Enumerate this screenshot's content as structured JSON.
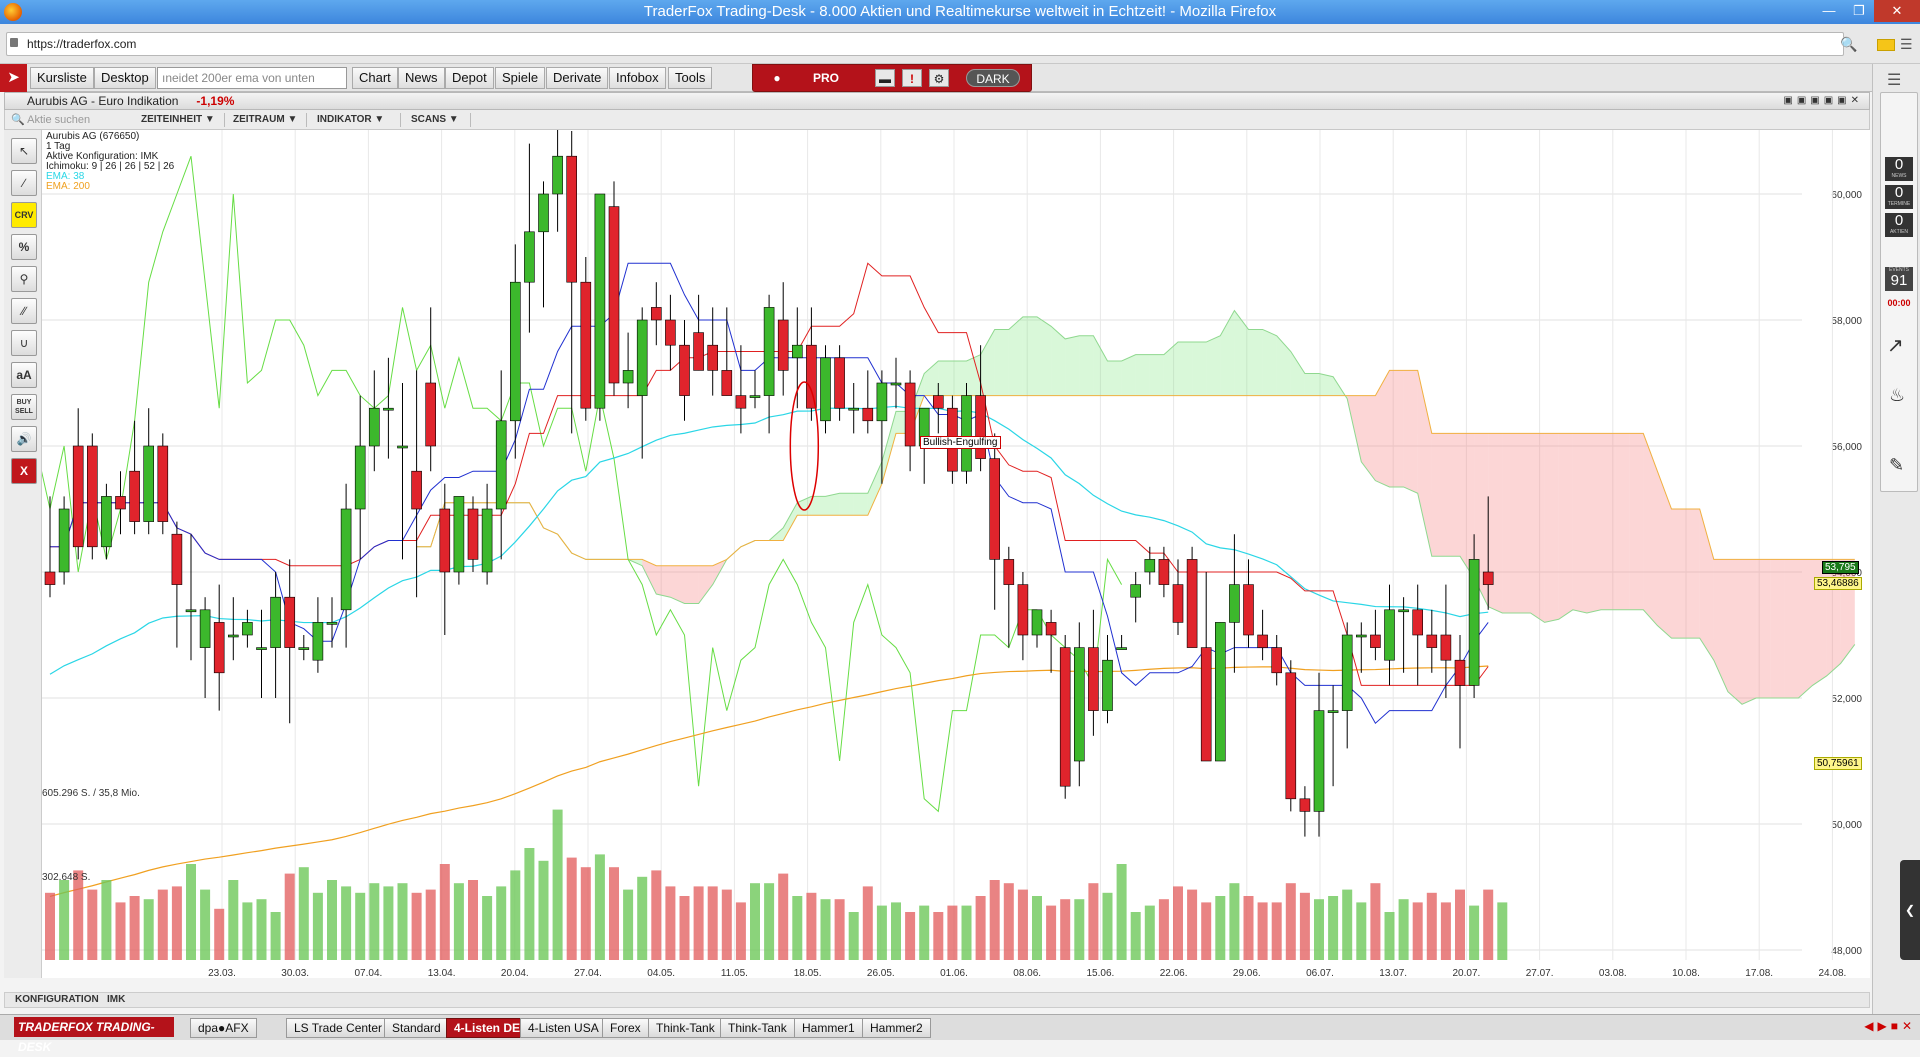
{
  "window": {
    "title": "TraderFox Trading-Desk - 8.000 Aktien und Realtimekurse weltweit in Echtzeit! - Mozilla Firefox"
  },
  "browser": {
    "url": "https://traderfox.com"
  },
  "menu": {
    "items": [
      "Kursliste",
      "Desktop",
      "Chart",
      "News",
      "Depot",
      "Spiele",
      "Derivate",
      "Infobox",
      "Tools"
    ],
    "search_placeholder": "ıneidet 200er ema von unten"
  },
  "pro_bar": {
    "pro_label": "PRO",
    "dark_label": "DARK"
  },
  "sidebar": {
    "news_count": "0",
    "news_label": "NEWS",
    "termine_count": "0",
    "termine_label": "TERMINE",
    "aktien_count": "0",
    "aktien_label": "AKTIEN",
    "events_label": "EVENTS",
    "events_count": "91",
    "events_time": "00:00"
  },
  "panel": {
    "title": "Aurubis AG - Euro Indikation",
    "change": "-1,19%"
  },
  "toolbar": {
    "search_placeholder": "Aktie suchen",
    "dropdowns": [
      "ZEITEINHEIT",
      "ZEITRAUM",
      "INDIKATOR",
      "SCANS"
    ]
  },
  "tools": [
    "CRV",
    "%",
    "aA",
    "BUY SELL",
    "X"
  ],
  "chart_info": {
    "name": "Aurubis AG (676650)",
    "period": "1 Tag",
    "config": "Aktive Konfiguration: IMK",
    "ichimoku": "Ichimoku: 9 | 26 | 26 | 52 | 26",
    "ema38": "EMA: 38",
    "ema200": "EMA: 200",
    "volume_top": "605.296 S. / 35,8 Mio.",
    "volume_mid": "302.648 S.",
    "pattern": "Bullish-Engulfing"
  },
  "chart_data": {
    "type": "candlestick",
    "y_ticks": [
      "60,000",
      "58,000",
      "56,000",
      "54,000",
      "52,000",
      "50,000",
      "48,000"
    ],
    "x_ticks": [
      "23.03.",
      "30.03.",
      "07.04.",
      "13.04.",
      "20.04.",
      "27.04.",
      "04.05.",
      "11.05.",
      "18.05.",
      "26.05.",
      "01.06.",
      "08.06.",
      "15.06.",
      "22.06.",
      "29.06.",
      "06.07.",
      "13.07.",
      "20.07.",
      "27.07.",
      "03.08.",
      "10.08.",
      "17.08.",
      "24.08."
    ],
    "price_labels": {
      "last": "53,795",
      "ema38": "53,46886",
      "ema200": "50,75961"
    },
    "candles": [
      {
        "o": 54.0,
        "h": 55.2,
        "l": 53.6,
        "c": 53.8
      },
      {
        "o": 54.0,
        "h": 55.2,
        "l": 53.8,
        "c": 55.0
      },
      {
        "o": 56.0,
        "h": 56.6,
        "l": 54.2,
        "c": 54.4
      },
      {
        "o": 56.0,
        "h": 56.2,
        "l": 54.2,
        "c": 54.4
      },
      {
        "o": 54.4,
        "h": 55.4,
        "l": 54.2,
        "c": 55.2
      },
      {
        "o": 55.2,
        "h": 55.6,
        "l": 54.6,
        "c": 55.0
      },
      {
        "o": 55.6,
        "h": 56.4,
        "l": 54.6,
        "c": 54.8
      },
      {
        "o": 54.8,
        "h": 56.6,
        "l": 54.6,
        "c": 56.0
      },
      {
        "o": 56.0,
        "h": 56.2,
        "l": 54.6,
        "c": 54.8
      },
      {
        "o": 54.6,
        "h": 54.8,
        "l": 52.8,
        "c": 53.8
      },
      {
        "o": 53.4,
        "h": 54.6,
        "l": 52.6,
        "c": 53.4
      },
      {
        "o": 52.8,
        "h": 53.6,
        "l": 52.0,
        "c": 53.4
      },
      {
        "o": 53.2,
        "h": 53.8,
        "l": 51.8,
        "c": 52.4
      },
      {
        "o": 53.0,
        "h": 53.6,
        "l": 52.6,
        "c": 53.0
      },
      {
        "o": 53.0,
        "h": 53.4,
        "l": 52.8,
        "c": 53.2
      },
      {
        "o": 52.8,
        "h": 53.4,
        "l": 52.0,
        "c": 52.8
      },
      {
        "o": 52.8,
        "h": 54.0,
        "l": 52.0,
        "c": 53.6
      },
      {
        "o": 53.6,
        "h": 54.2,
        "l": 51.6,
        "c": 52.8
      },
      {
        "o": 52.8,
        "h": 53.0,
        "l": 52.6,
        "c": 52.8
      },
      {
        "o": 52.6,
        "h": 53.6,
        "l": 52.4,
        "c": 53.2
      },
      {
        "o": 53.2,
        "h": 53.6,
        "l": 52.8,
        "c": 53.2
      },
      {
        "o": 53.4,
        "h": 55.4,
        "l": 52.8,
        "c": 55.0
      },
      {
        "o": 55.0,
        "h": 56.8,
        "l": 54.2,
        "c": 56.0
      },
      {
        "o": 56.0,
        "h": 57.2,
        "l": 55.6,
        "c": 56.6
      },
      {
        "o": 56.6,
        "h": 57.4,
        "l": 55.8,
        "c": 56.6
      },
      {
        "o": 56.0,
        "h": 57.0,
        "l": 54.2,
        "c": 56.0
      },
      {
        "o": 55.6,
        "h": 57.2,
        "l": 53.6,
        "c": 55.0
      },
      {
        "o": 57.0,
        "h": 58.2,
        "l": 55.6,
        "c": 56.0
      },
      {
        "o": 55.0,
        "h": 55.4,
        "l": 53.0,
        "c": 54.0
      },
      {
        "o": 54.0,
        "h": 55.0,
        "l": 53.8,
        "c": 55.2
      },
      {
        "o": 55.0,
        "h": 55.2,
        "l": 54.0,
        "c": 54.2
      },
      {
        "o": 54.0,
        "h": 55.4,
        "l": 53.8,
        "c": 55.0
      },
      {
        "o": 55.0,
        "h": 57.2,
        "l": 54.2,
        "c": 56.4
      },
      {
        "o": 56.4,
        "h": 59.2,
        "l": 55.8,
        "c": 58.6
      },
      {
        "o": 58.6,
        "h": 60.8,
        "l": 57.8,
        "c": 59.4
      },
      {
        "o": 59.4,
        "h": 60.2,
        "l": 58.2,
        "c": 60.0
      },
      {
        "o": 60.0,
        "h": 62.0,
        "l": 59.4,
        "c": 60.6
      },
      {
        "o": 60.6,
        "h": 61.0,
        "l": 56.2,
        "c": 58.6
      },
      {
        "o": 58.6,
        "h": 59.0,
        "l": 56.4,
        "c": 56.6
      },
      {
        "o": 56.6,
        "h": 59.8,
        "l": 56.4,
        "c": 60.0
      },
      {
        "o": 59.8,
        "h": 60.2,
        "l": 56.8,
        "c": 57.0
      },
      {
        "o": 57.0,
        "h": 57.8,
        "l": 56.6,
        "c": 57.2
      },
      {
        "o": 56.8,
        "h": 58.2,
        "l": 55.8,
        "c": 58.0
      },
      {
        "o": 58.2,
        "h": 58.6,
        "l": 57.6,
        "c": 58.0
      },
      {
        "o": 58.0,
        "h": 58.4,
        "l": 57.2,
        "c": 57.6
      },
      {
        "o": 57.6,
        "h": 58.0,
        "l": 56.4,
        "c": 56.8
      },
      {
        "o": 57.8,
        "h": 58.4,
        "l": 57.2,
        "c": 57.2
      },
      {
        "o": 57.6,
        "h": 58.2,
        "l": 56.8,
        "c": 57.2
      },
      {
        "o": 57.2,
        "h": 58.2,
        "l": 56.8,
        "c": 56.8
      },
      {
        "o": 56.8,
        "h": 57.6,
        "l": 56.2,
        "c": 56.6
      },
      {
        "o": 56.8,
        "h": 57.2,
        "l": 56.6,
        "c": 56.8
      },
      {
        "o": 56.8,
        "h": 58.4,
        "l": 56.2,
        "c": 58.2
      },
      {
        "o": 58.0,
        "h": 58.6,
        "l": 56.8,
        "c": 57.2
      },
      {
        "o": 57.4,
        "h": 58.2,
        "l": 56.6,
        "c": 57.6
      },
      {
        "o": 57.6,
        "h": 58.2,
        "l": 56.4,
        "c": 56.6
      },
      {
        "o": 56.4,
        "h": 57.6,
        "l": 56.2,
        "c": 57.4
      },
      {
        "o": 57.4,
        "h": 57.6,
        "l": 56.4,
        "c": 56.6
      },
      {
        "o": 56.6,
        "h": 57.0,
        "l": 56.2,
        "c": 56.6
      },
      {
        "o": 56.6,
        "h": 57.2,
        "l": 56.2,
        "c": 56.4
      },
      {
        "o": 56.4,
        "h": 57.2,
        "l": 55.4,
        "c": 57.0
      },
      {
        "o": 57.0,
        "h": 57.4,
        "l": 56.6,
        "c": 57.0
      },
      {
        "o": 57.0,
        "h": 57.2,
        "l": 55.6,
        "c": 56.0
      },
      {
        "o": 56.0,
        "h": 56.6,
        "l": 55.4,
        "c": 56.6
      },
      {
        "o": 56.8,
        "h": 57.0,
        "l": 56.2,
        "c": 56.6
      },
      {
        "o": 56.6,
        "h": 56.8,
        "l": 55.4,
        "c": 55.6
      },
      {
        "o": 55.6,
        "h": 57.0,
        "l": 55.4,
        "c": 56.8
      },
      {
        "o": 56.8,
        "h": 57.6,
        "l": 55.6,
        "c": 55.8
      },
      {
        "o": 55.8,
        "h": 56.2,
        "l": 53.4,
        "c": 54.2
      },
      {
        "o": 54.2,
        "h": 54.4,
        "l": 52.8,
        "c": 53.8
      },
      {
        "o": 53.8,
        "h": 54.0,
        "l": 52.6,
        "c": 53.0
      },
      {
        "o": 53.0,
        "h": 53.4,
        "l": 52.8,
        "c": 53.4
      },
      {
        "o": 53.2,
        "h": 53.4,
        "l": 52.4,
        "c": 53.0
      },
      {
        "o": 52.8,
        "h": 53.0,
        "l": 50.4,
        "c": 50.6
      },
      {
        "o": 51.0,
        "h": 53.2,
        "l": 50.6,
        "c": 52.8
      },
      {
        "o": 52.8,
        "h": 53.4,
        "l": 51.4,
        "c": 51.8
      },
      {
        "o": 51.8,
        "h": 53.0,
        "l": 51.6,
        "c": 52.6
      },
      {
        "o": 52.8,
        "h": 53.0,
        "l": 52.8,
        "c": 52.8
      },
      {
        "o": 53.6,
        "h": 54.0,
        "l": 53.2,
        "c": 53.8
      },
      {
        "o": 54.0,
        "h": 54.4,
        "l": 53.8,
        "c": 54.2
      },
      {
        "o": 54.2,
        "h": 54.4,
        "l": 53.6,
        "c": 53.8
      },
      {
        "o": 53.8,
        "h": 54.2,
        "l": 53.0,
        "c": 53.2
      },
      {
        "o": 54.2,
        "h": 54.4,
        "l": 52.8,
        "c": 52.8
      },
      {
        "o": 52.8,
        "h": 54.0,
        "l": 51.2,
        "c": 51.0
      },
      {
        "o": 51.0,
        "h": 53.2,
        "l": 51.0,
        "c": 53.2
      },
      {
        "o": 53.2,
        "h": 54.6,
        "l": 52.4,
        "c": 53.8
      },
      {
        "o": 53.8,
        "h": 54.2,
        "l": 52.8,
        "c": 53.0
      },
      {
        "o": 53.0,
        "h": 53.4,
        "l": 52.6,
        "c": 52.8
      },
      {
        "o": 52.8,
        "h": 53.0,
        "l": 52.2,
        "c": 52.4
      },
      {
        "o": 52.4,
        "h": 52.6,
        "l": 50.2,
        "c": 50.4
      },
      {
        "o": 50.4,
        "h": 50.6,
        "l": 49.8,
        "c": 50.2
      },
      {
        "o": 50.2,
        "h": 52.4,
        "l": 49.8,
        "c": 51.8
      },
      {
        "o": 51.8,
        "h": 52.2,
        "l": 50.6,
        "c": 51.8
      },
      {
        "o": 51.8,
        "h": 53.2,
        "l": 51.2,
        "c": 53.0
      },
      {
        "o": 53.0,
        "h": 53.2,
        "l": 52.4,
        "c": 53.0
      },
      {
        "o": 53.0,
        "h": 53.4,
        "l": 52.6,
        "c": 52.8
      },
      {
        "o": 52.6,
        "h": 53.8,
        "l": 52.2,
        "c": 53.4
      },
      {
        "o": 53.4,
        "h": 53.6,
        "l": 52.4,
        "c": 53.4
      },
      {
        "o": 53.4,
        "h": 53.8,
        "l": 52.2,
        "c": 53.0
      },
      {
        "o": 53.0,
        "h": 53.4,
        "l": 52.4,
        "c": 52.8
      },
      {
        "o": 53.0,
        "h": 53.8,
        "l": 52.0,
        "c": 52.6
      },
      {
        "o": 52.6,
        "h": 53.0,
        "l": 51.2,
        "c": 52.2
      },
      {
        "o": 52.2,
        "h": 54.6,
        "l": 52.0,
        "c": 54.2
      },
      {
        "o": 54.0,
        "h": 55.2,
        "l": 53.4,
        "c": 53.8
      }
    ],
    "volumes": [
      0.42,
      0.5,
      0.56,
      0.44,
      0.5,
      0.36,
      0.4,
      0.38,
      0.44,
      0.46,
      0.6,
      0.44,
      0.32,
      0.5,
      0.36,
      0.38,
      0.3,
      0.54,
      0.58,
      0.42,
      0.5,
      0.46,
      0.42,
      0.48,
      0.46,
      0.48,
      0.42,
      0.44,
      0.6,
      0.48,
      0.5,
      0.4,
      0.46,
      0.56,
      0.7,
      0.62,
      0.94,
      0.64,
      0.58,
      0.66,
      0.58,
      0.44,
      0.52,
      0.56,
      0.46,
      0.4,
      0.46,
      0.46,
      0.44,
      0.36,
      0.48,
      0.48,
      0.54,
      0.4,
      0.42,
      0.38,
      0.38,
      0.3,
      0.46,
      0.34,
      0.36,
      0.3,
      0.34,
      0.3,
      0.34,
      0.34,
      0.4,
      0.5,
      0.48,
      0.44,
      0.4,
      0.34,
      0.38,
      0.38,
      0.48,
      0.42,
      0.6,
      0.3,
      0.34,
      0.38,
      0.46,
      0.44,
      0.36,
      0.4,
      0.48,
      0.4,
      0.36,
      0.36,
      0.48,
      0.42,
      0.38,
      0.4,
      0.44,
      0.36,
      0.48,
      0.3,
      0.38,
      0.36,
      0.42,
      0.36,
      0.44,
      0.34,
      0.44,
      0.36
    ]
  }
}
